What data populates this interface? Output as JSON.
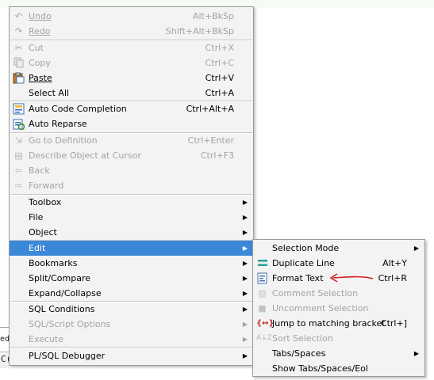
{
  "background": {
    "left_label": "ed",
    "left_code": "C("
  },
  "main_menu": {
    "items": [
      {
        "label": "Undo",
        "shortcut": "Alt+BkSp",
        "icon": "undo-icon",
        "disabled": true
      },
      {
        "label": "Redo",
        "shortcut": "Shift+Alt+BkSp",
        "icon": "redo-icon",
        "disabled": true
      },
      {
        "label": "Cut",
        "shortcut": "Ctrl+X",
        "icon": "scissors-icon",
        "disabled": true
      },
      {
        "label": "Copy",
        "shortcut": "Ctrl+C",
        "icon": "copy-icon",
        "disabled": true
      },
      {
        "label": "Paste",
        "shortcut": "Ctrl+V",
        "icon": "clipboard-icon",
        "disabled": false
      },
      {
        "label": "Select All",
        "shortcut": "Ctrl+A",
        "icon": "",
        "disabled": false
      },
      {
        "label": "Auto Code Completion",
        "shortcut": "Ctrl+Alt+A",
        "icon": "code-completion-icon",
        "disabled": false
      },
      {
        "label": "Auto Reparse",
        "shortcut": "",
        "icon": "reparse-icon",
        "disabled": false
      },
      {
        "label": "Go to Definition",
        "shortcut": "Ctrl+Enter",
        "icon": "definition-icon",
        "disabled": true
      },
      {
        "label": "Describe Object at Cursor",
        "shortcut": "Ctrl+F3",
        "icon": "describe-icon",
        "disabled": true
      },
      {
        "label": "Back",
        "shortcut": "",
        "icon": "back-arrow-icon",
        "disabled": true
      },
      {
        "label": "Forward",
        "shortcut": "",
        "icon": "forward-arrow-icon",
        "disabled": true
      },
      {
        "label": "Toolbox",
        "shortcut": "",
        "icon": "",
        "disabled": false,
        "submenu": true
      },
      {
        "label": "File",
        "shortcut": "",
        "icon": "",
        "disabled": false,
        "submenu": true
      },
      {
        "label": "Object",
        "shortcut": "",
        "icon": "",
        "disabled": false,
        "submenu": true
      },
      {
        "label": "Edit",
        "shortcut": "",
        "icon": "",
        "disabled": false,
        "submenu": true,
        "highlighted": true
      },
      {
        "label": "Bookmarks",
        "shortcut": "",
        "icon": "",
        "disabled": false,
        "submenu": true
      },
      {
        "label": "Split/Compare",
        "shortcut": "",
        "icon": "",
        "disabled": false,
        "submenu": true
      },
      {
        "label": "Expand/Collapse",
        "shortcut": "",
        "icon": "",
        "disabled": false,
        "submenu": true
      },
      {
        "label": "SQL Conditions",
        "shortcut": "",
        "icon": "",
        "disabled": false,
        "submenu": true
      },
      {
        "label": "SQL/Script Options",
        "shortcut": "",
        "icon": "",
        "disabled": true,
        "submenu": true
      },
      {
        "label": "Execute",
        "shortcut": "",
        "icon": "",
        "disabled": true,
        "submenu": true
      },
      {
        "label": "PL/SQL Debugger",
        "shortcut": "",
        "icon": "",
        "disabled": false,
        "submenu": true
      }
    ]
  },
  "edit_submenu": {
    "items": [
      {
        "label": "Selection Mode",
        "shortcut": "",
        "icon": "",
        "disabled": false,
        "submenu": true
      },
      {
        "label": "Duplicate Line",
        "shortcut": "Alt+Y",
        "icon": "duplicate-line-icon",
        "disabled": false
      },
      {
        "label": "Format Text",
        "shortcut": "Ctrl+R",
        "icon": "format-text-icon",
        "disabled": false
      },
      {
        "label": "Comment Selection",
        "shortcut": "",
        "icon": "comment-icon",
        "disabled": true
      },
      {
        "label": "Uncomment Selection",
        "shortcut": "",
        "icon": "uncomment-icon",
        "disabled": true
      },
      {
        "label": "Jump to matching bracket",
        "shortcut": "Ctrl+]",
        "icon": "bracket-icon",
        "disabled": false
      },
      {
        "label": "Sort Selection",
        "shortcut": "",
        "icon": "sort-az-icon",
        "disabled": true
      },
      {
        "label": "Tabs/Spaces",
        "shortcut": "",
        "icon": "",
        "disabled": false,
        "submenu": true
      },
      {
        "label": "Show Tabs/Spaces/Eol",
        "shortcut": "",
        "icon": "",
        "disabled": false
      }
    ]
  },
  "colors": {
    "highlight": "#3b88d8",
    "annotation_arrow": "#d42020",
    "disabled_text": "#a3a3a3"
  }
}
